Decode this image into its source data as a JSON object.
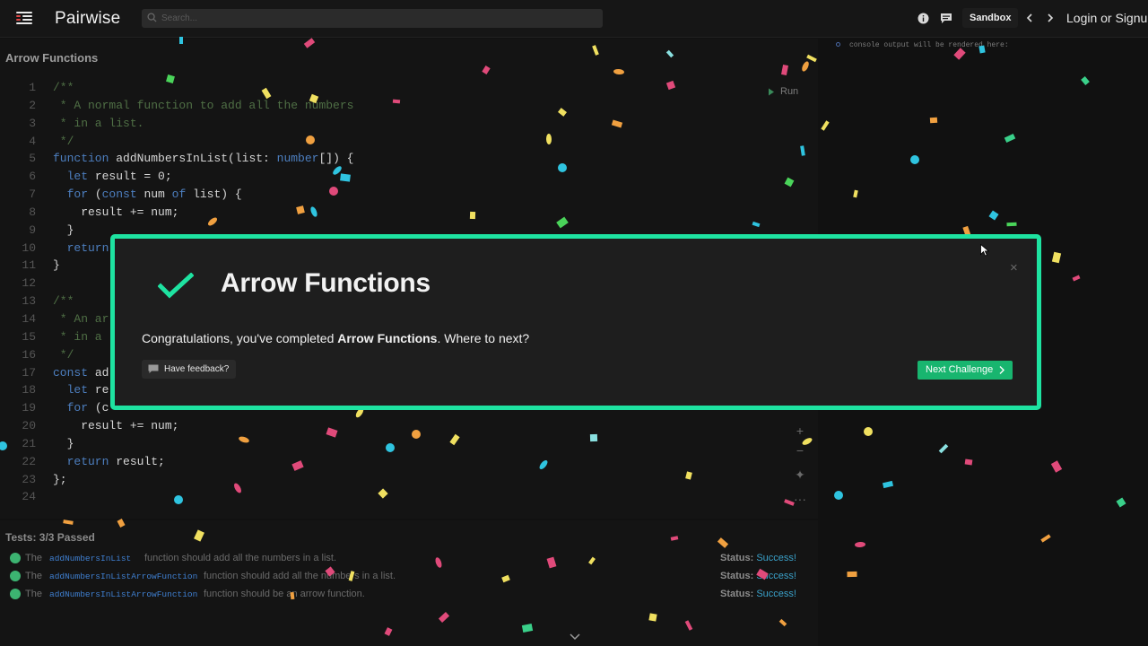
{
  "topbar": {
    "brand": "Pairwise",
    "search_placeholder": "Search...",
    "sandbox_label": "Sandbox",
    "login_label": "Login or Signup"
  },
  "editor": {
    "title": "Arrow Functions",
    "run_label": "Run",
    "line_numbers": [
      "1",
      "2",
      "3",
      "4",
      "5",
      "6",
      "7",
      "8",
      "9",
      "10",
      "11",
      "12",
      "13",
      "14",
      "15",
      "16",
      "17",
      "18",
      "19",
      "20",
      "21",
      "22",
      "23",
      "24"
    ],
    "lines": [
      [
        {
          "c": "c",
          "t": "/**"
        }
      ],
      [
        {
          "c": "c",
          "t": " * A normal function to add all the numbers"
        }
      ],
      [
        {
          "c": "c",
          "t": " * in a list."
        }
      ],
      [
        {
          "c": "c",
          "t": " */"
        }
      ],
      [
        {
          "c": "k",
          "t": "function "
        },
        {
          "c": "f",
          "t": "addNumbersInList(list: "
        },
        {
          "c": "t",
          "t": "number"
        },
        {
          "c": "f",
          "t": "[]) {"
        }
      ],
      [
        {
          "c": "k",
          "t": "  let "
        },
        {
          "c": "f",
          "t": "result = 0;"
        }
      ],
      [
        {
          "c": "k",
          "t": "  for "
        },
        {
          "c": "f",
          "t": "("
        },
        {
          "c": "k",
          "t": "const "
        },
        {
          "c": "f",
          "t": "num "
        },
        {
          "c": "k",
          "t": "of "
        },
        {
          "c": "f",
          "t": "list) {"
        }
      ],
      [
        {
          "c": "f",
          "t": "    result += num;"
        }
      ],
      [
        {
          "c": "f",
          "t": "  }"
        }
      ],
      [
        {
          "c": "k",
          "t": "  return"
        }
      ],
      [
        {
          "c": "f",
          "t": "}"
        }
      ],
      [
        {
          "c": "f",
          "t": ""
        }
      ],
      [
        {
          "c": "c",
          "t": "/**"
        }
      ],
      [
        {
          "c": "c",
          "t": " * An ar"
        }
      ],
      [
        {
          "c": "c",
          "t": " * in a "
        }
      ],
      [
        {
          "c": "c",
          "t": " */"
        }
      ],
      [
        {
          "c": "k",
          "t": "const "
        },
        {
          "c": "f",
          "t": "ad"
        }
      ],
      [
        {
          "c": "k",
          "t": "  let "
        },
        {
          "c": "f",
          "t": "re"
        }
      ],
      [
        {
          "c": "k",
          "t": "  for "
        },
        {
          "c": "f",
          "t": "(c"
        }
      ],
      [
        {
          "c": "f",
          "t": "    result += num;"
        }
      ],
      [
        {
          "c": "f",
          "t": "  }"
        }
      ],
      [
        {
          "c": "k",
          "t": "  return "
        },
        {
          "c": "f",
          "t": "result;"
        }
      ],
      [
        {
          "c": "f",
          "t": "};"
        }
      ],
      [
        {
          "c": "f",
          "t": ""
        }
      ]
    ]
  },
  "console": {
    "placeholder": "console output will be rendered here:"
  },
  "tests": {
    "title": "Tests: 3/3 Passed",
    "rows": [
      {
        "the": "The",
        "fn": "addNumbersInList",
        "desc": "function should add all the numbers in a list.",
        "status_label": "Status:",
        "status_value": "Success!"
      },
      {
        "the": "The",
        "fn": "addNumbersInListArrowFunction",
        "desc": "function should add all the numbers in a list.",
        "status_label": "Status:",
        "status_value": "Success!"
      },
      {
        "the": "The",
        "fn": "addNumbersInListArrowFunction",
        "desc": "function should be an arrow function.",
        "status_label": "Status:",
        "status_value": "Success!"
      }
    ]
  },
  "modal": {
    "title": "Arrow Functions",
    "congrats_prefix": "Congratulations, you've completed ",
    "congrats_bold": "Arrow Functions",
    "congrats_suffix": ". Where to next?",
    "feedback_label": "Have feedback?",
    "next_label": "Next Challenge",
    "close_symbol": "×"
  },
  "colors": {
    "accent": "#1ee3a1",
    "next_button": "#18b56f",
    "success": "#3aa0c8",
    "check": "#1ee3a1"
  }
}
